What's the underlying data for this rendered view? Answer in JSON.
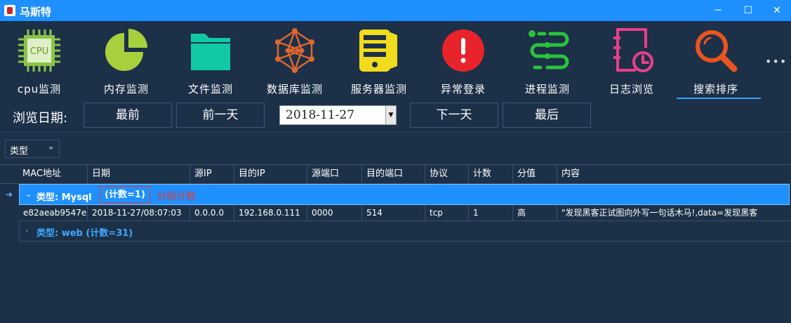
{
  "window": {
    "title": "马斯特",
    "minimize_glyph": "─",
    "maximize_glyph": "☐",
    "close_glyph": "✕"
  },
  "toolbar": {
    "items": [
      {
        "label": "cpu监测",
        "icon": "cpu-icon",
        "color": "#8bc34a"
      },
      {
        "label": "内存监测",
        "icon": "pie-chart-icon",
        "color": "#a8d03c"
      },
      {
        "label": "文件监测",
        "icon": "folder-icon",
        "color": "#11c9a4"
      },
      {
        "label": "数据库监测",
        "icon": "network-icon",
        "color": "#e0672c"
      },
      {
        "label": "服务器监测",
        "icon": "server-icon",
        "color": "#f0dc1c"
      },
      {
        "label": "异常登录",
        "icon": "alert-icon",
        "color": "#e8232b"
      },
      {
        "label": "进程监测",
        "icon": "process-icon",
        "color": "#29c43b"
      },
      {
        "label": "日志浏览",
        "icon": "log-clock-icon",
        "color": "#e8408a"
      },
      {
        "label": "搜索排序",
        "icon": "search-icon",
        "color": "#ea5420"
      }
    ],
    "active_index": 8,
    "more_glyph": "•••"
  },
  "date_nav": {
    "label": "浏览日期:",
    "first_label": "最前",
    "prev_label": "前一天",
    "date_value": "2018-11-27",
    "next_label": "下一天",
    "last_label": "最后"
  },
  "group_panel": {
    "chip_label": "类型",
    "chip_icon": "sort-icon"
  },
  "grid": {
    "columns": [
      "MAC地址",
      "日期",
      "源IP",
      "目的IP",
      "源端口",
      "目的端口",
      "协议",
      "计数",
      "分值",
      "内容"
    ],
    "row_indicator": "➔",
    "groups": [
      {
        "label": "类型: Mysql",
        "count_label": "(计数=1)",
        "annotation": "分组计数",
        "expanded": true,
        "rows": [
          [
            "e82aeab9547e",
            "2018-11-27/08:07:03",
            "0.0.0.0",
            "192.168.0.111",
            "0000",
            "514",
            "tcp",
            "1",
            "高",
            "\"发现黑客正试图向外写一句话木马!,data=发现黑客"
          ]
        ]
      },
      {
        "label": "类型: web (计数=31)",
        "expanded": false
      }
    ]
  },
  "colors": {
    "background": "#1c3048",
    "titlebar": "#1e90ff",
    "selection": "#1e90ff",
    "annotation": "#e53935"
  }
}
